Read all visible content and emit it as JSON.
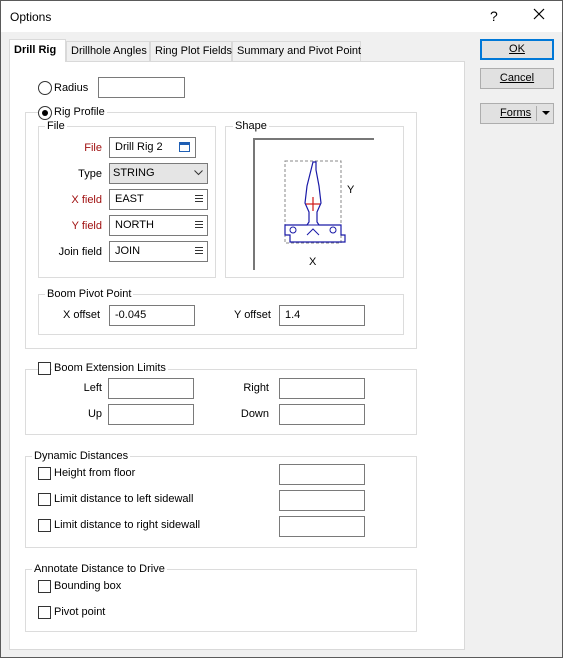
{
  "window": {
    "title": "Options",
    "help_glyph": "?",
    "close_icon": "close-icon"
  },
  "tabs": [
    {
      "label": "Drill Rig",
      "active": true
    },
    {
      "label": "Drillhole Angles"
    },
    {
      "label": "Ring Plot Fields"
    },
    {
      "label": "Summary and Pivot Point"
    }
  ],
  "buttons": {
    "ok": "OK",
    "cancel": "Cancel",
    "forms": "Forms"
  },
  "drill_rig": {
    "radius": {
      "label": "Radius",
      "value": "",
      "selected": false
    },
    "rig_profile": {
      "label": "Rig Profile",
      "selected": true
    },
    "file_group": {
      "title": "File",
      "file": {
        "label": "File",
        "value": "Drill Rig 2"
      },
      "type": {
        "label": "Type",
        "value": "STRING"
      },
      "x_field": {
        "label": "X field",
        "value": "EAST"
      },
      "y_field": {
        "label": "Y field",
        "value": "NORTH"
      },
      "join_field": {
        "label": "Join field",
        "value": "JOIN"
      }
    },
    "shape_group": {
      "title": "Shape",
      "x_axis": "X",
      "y_axis": "Y"
    },
    "boom_pivot": {
      "title": "Boom Pivot Point",
      "x_offset": {
        "label": "X offset",
        "value": "-0.045"
      },
      "y_offset": {
        "label": "Y offset",
        "value": "1.4"
      }
    },
    "boom_extension": {
      "title": "Boom Extension Limits",
      "checked": false,
      "left": {
        "label": "Left",
        "value": ""
      },
      "right": {
        "label": "Right",
        "value": ""
      },
      "up": {
        "label": "Up",
        "value": ""
      },
      "down": {
        "label": "Down",
        "value": ""
      }
    },
    "dynamic_distances": {
      "title": "Dynamic Distances",
      "items": [
        {
          "label": "Height from floor",
          "checked": false,
          "value": ""
        },
        {
          "label": "Limit distance to left sidewall",
          "checked": false,
          "value": ""
        },
        {
          "label": "Limit distance to right sidewall",
          "checked": false,
          "value": ""
        }
      ]
    },
    "annotate": {
      "title": "Annotate Distance to Drive",
      "bounding_box": {
        "label": "Bounding box",
        "checked": false
      },
      "pivot_point": {
        "label": "Pivot point",
        "checked": false
      }
    }
  }
}
